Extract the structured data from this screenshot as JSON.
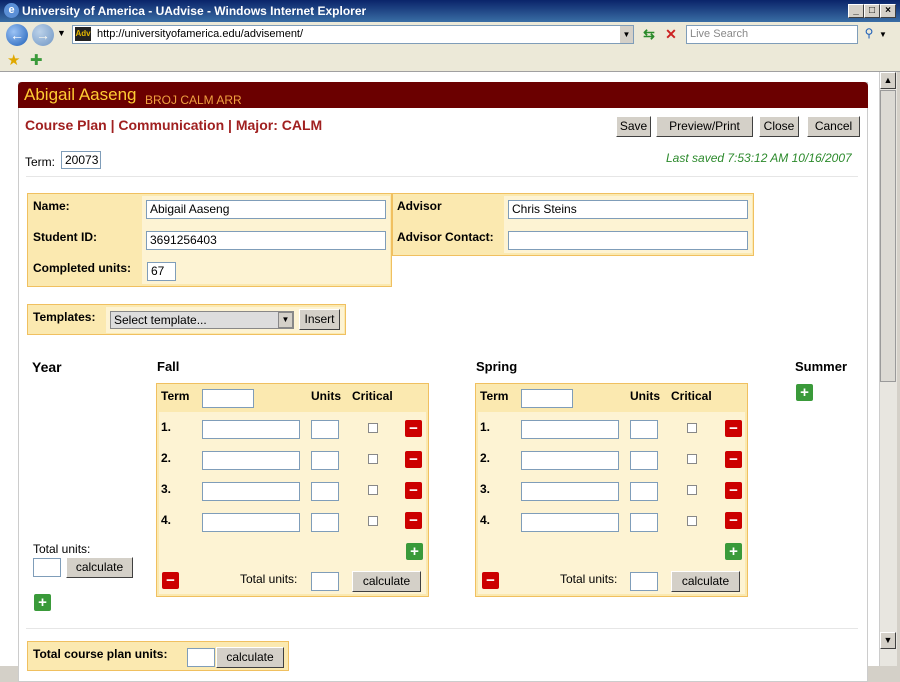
{
  "window": {
    "title": "University of America - UAdvise - Windows Internet Explorer"
  },
  "browser": {
    "url": "http://universityofamerica.edu/advisement/",
    "search_placeholder": "Live Search"
  },
  "student": {
    "name": "Abigail Aaseng",
    "codes": "BROJ CALM ARR"
  },
  "plan": {
    "title": "Course Plan | Communication | Major: CALM",
    "last_saved": "Last saved 7:53:12 AM 10/16/2007"
  },
  "toolbar": {
    "save": "Save",
    "preview": "Preview/Print",
    "close": "Close",
    "cancel": "Cancel"
  },
  "term": {
    "label": "Term:",
    "value": "20073"
  },
  "info": {
    "name_label": "Name:",
    "name_value": "Abigail Aaseng",
    "id_label": "Student ID:",
    "id_value": "3691256403",
    "units_label": "Completed units:",
    "units_value": "67",
    "advisor_label": "Advisor",
    "advisor_value": "Chris Steins",
    "contact_label": "Advisor Contact:",
    "contact_value": ""
  },
  "templates": {
    "label": "Templates:",
    "selected": "Select template...",
    "insert": "Insert"
  },
  "year": {
    "label": "Year",
    "total_label": "Total units:",
    "calculate": "calculate"
  },
  "fall": {
    "title": "Fall",
    "term_header": "Term",
    "units_header": "Units",
    "critical_header": "Critical",
    "rows": [
      "1.",
      "2.",
      "3.",
      "4."
    ],
    "total_label": "Total units:",
    "calculate": "calculate"
  },
  "spring": {
    "title": "Spring",
    "term_header": "Term",
    "units_header": "Units",
    "critical_header": "Critical",
    "rows": [
      "1.",
      "2.",
      "3.",
      "4."
    ],
    "total_label": "Total units:",
    "calculate": "calculate"
  },
  "summer": {
    "title": "Summer"
  },
  "plan_total": {
    "label": "Total course plan units:",
    "calculate": "calculate"
  },
  "colors": {
    "header_bg": "#6b0000",
    "name_color": "#ffcc33",
    "title_color": "#a02020",
    "panel_bg": "#fbe9b0",
    "saved_color": "#2c8a2c"
  }
}
